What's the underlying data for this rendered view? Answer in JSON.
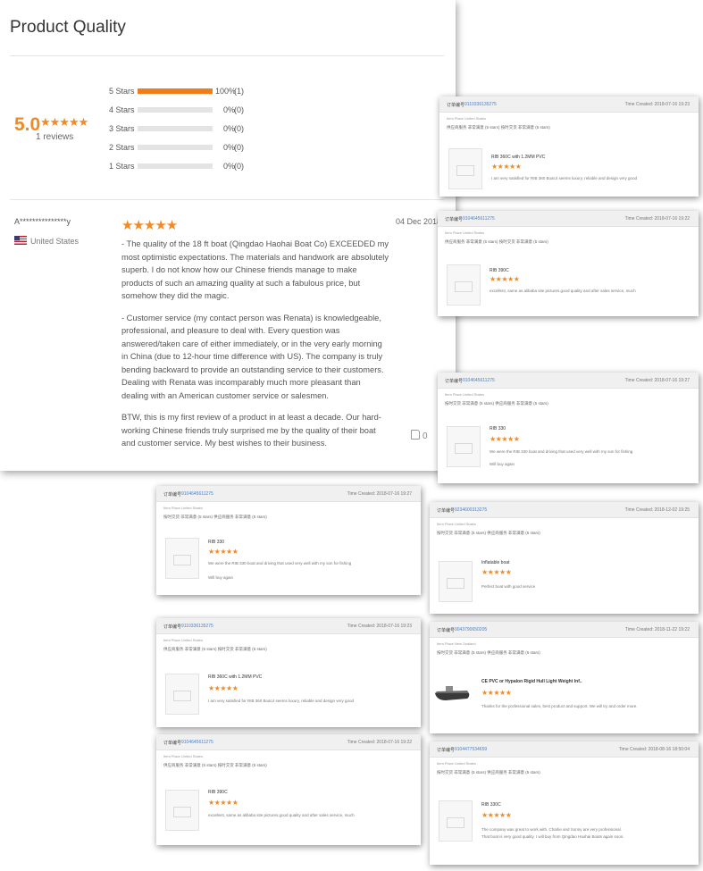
{
  "main": {
    "title": "Product Quality",
    "score": "5.0",
    "score_stars": "★★★★★",
    "reviews_count": "1 reviews",
    "breakdown": [
      {
        "label": "5 Stars",
        "fill": 1.0,
        "pct": "100%",
        "count": "(1)"
      },
      {
        "label": "4 Stars",
        "fill": 0.0,
        "pct": "0%",
        "count": "(0)"
      },
      {
        "label": "3 Stars",
        "fill": 0.0,
        "pct": "0%",
        "count": "(0)"
      },
      {
        "label": "2 Stars",
        "fill": 0.0,
        "pct": "0%",
        "count": "(0)"
      },
      {
        "label": "1 Stars",
        "fill": 0.0,
        "pct": "0%",
        "count": "(0)"
      }
    ],
    "review": {
      "reviewer": "A***************y",
      "country": "United States",
      "stars": "★★★★★",
      "date": "04 Dec 2018",
      "paragraphs": [
        "- The quality of the 18 ft boat (Qingdao Haohai Boat Co) EXCEEDED my most optimistic expectations. The materials and handwork are absolutely superb. I do not know how our Chinese friends manage to make products of such an amazing quality at such a fabulous price, but somehow they did the magic.",
        "- Customer service (my contact person was Renata) is knowledgeable, professional, and pleasure to deal with. Every question was answered/taken care of either immediately, or in the very early morning in China (due to 12-hour time difference with US). The company is truly bending backward to provide an outstanding service to their customers. Dealing with Renata was incomparably much more pleasant than dealing with an American customer service or salesmen.",
        "BTW, this is my first review of a product in at least a decade. Our hard-working Chinese friends truly surprised me by the quality of their boat and customer service. My best wishes to their business."
      ],
      "likes": "0"
    }
  },
  "cards": [
    {
      "oid_label": "订单编号",
      "order": "9110336135275",
      "time": "Time Created: 2018-07-16 19:23",
      "seller": "Item Place United States",
      "tags": "供应商服务  非常满意 (5 stars)     按时交货  非常满意 (5 stars)",
      "product": "RIB 360C with 1.2MM PVC",
      "stars": "★★★★★",
      "text": "I am very satisfied for RIB 360 Boat,it seems luxury, reliable and design very good",
      "text2": ""
    },
    {
      "oid_label": "订单编号",
      "order": "9104645611275",
      "time": "Time Created: 2018-07-16 19:22",
      "seller": "Item Place United States",
      "tags": "供应商服务  非常满意 (5 stars)     按时交货  非常满意 (5 stars)",
      "product": "RIB 390C",
      "stars": "★★★★★",
      "text": "excellent, same as alibaba site pictures.good quality and after sales service, much",
      "text2": ""
    },
    {
      "oid_label": "订单编号",
      "order": "9104645611275",
      "time": "Time Created: 2018-07-16 19:27",
      "seller": "Item Place United States",
      "tags": "按时交货  非常满意 (5 stars)     供应商服务  非常满意 (5 stars)",
      "product": "RIB 330",
      "stars": "★★★★★",
      "text": "We were the RIB 330 boat and driving that used very well with my son for fishing",
      "text2": "Will buy again"
    },
    {
      "oid_label": "订单编号",
      "order": "9104645611275",
      "time": "Time Created: 2018-07-16 19:27",
      "seller": "Item Place United States",
      "tags": "按时交货  非常满意 (5 stars)     供应商服务  非常满意 (5 stars)",
      "product": "RIB 330",
      "stars": "★★★★★",
      "text": "We were the RIB 330 boat and driving that used very well with my son for fishing",
      "text2": "Will buy again"
    },
    {
      "oid_label": "订单编号",
      "order": "9234600313275",
      "time": "Time Created: 2018-12-02 19:25",
      "seller": "Item Place United States",
      "tags": "按时交货  非常满意 (5 stars)     供应商服务  非常满意 (5 stars)",
      "product": "Inflatable boat",
      "stars": "★★★★★",
      "text": "Perfect boat with good service",
      "text2": ""
    },
    {
      "oid_label": "订单编号",
      "order": "9110336135275",
      "time": "Time Created: 2018-07-16 19:23",
      "seller": "Item Place United States",
      "tags": "供应商服务  非常满意 (5 stars)     按时交货  非常满意 (5 stars)",
      "product": "RIB 360C with 1.2MM PVC",
      "stars": "★★★★★",
      "text": "I am very satisfied for RIB 360 Boat,it seems luxury, reliable and design very good",
      "text2": ""
    },
    {
      "oid_label": "订单编号",
      "order": "9043790650205",
      "time": "Time Created: 2018-11-22 19:22",
      "seller": "Item Place New Zealand",
      "tags": "按时交货  非常满意 (5 stars)     供应商服务  非常满意 (5 stars)",
      "product": "CE PVC or Hypalon Rigid Hull Light Weight Inf..",
      "stars": "★★★★★",
      "text": "Thanks for the professional sales, best product and support. We will try and order more.",
      "text2": ""
    },
    {
      "oid_label": "订单编号",
      "order": "9104645611275",
      "time": "Time Created: 2018-07-16 19:22",
      "seller": "Item Place United States",
      "tags": "供应商服务  非常满意 (5 stars)     按时交货  非常满意 (5 stars)",
      "product": "RIB 390C",
      "stars": "★★★★★",
      "text": "excellent, same as alibaba site pictures.good quality and after sales service, much",
      "text2": ""
    },
    {
      "oid_label": "订单编号",
      "order": "9104477534659",
      "time": "Time Created: 2018-08-16 18:50:04",
      "seller": "Item Place United States",
      "tags": "按时交货  非常满意 (5 stars)     供应商服务  非常满意 (5 stars)",
      "product": "RIB 330C",
      "stars": "★★★★★",
      "text": "The company was great to work with. Charlie and Sonny are very professional.",
      "text2": "That boat is very good quality. I will buy from Qingdao Haohai Boats again soon."
    }
  ]
}
